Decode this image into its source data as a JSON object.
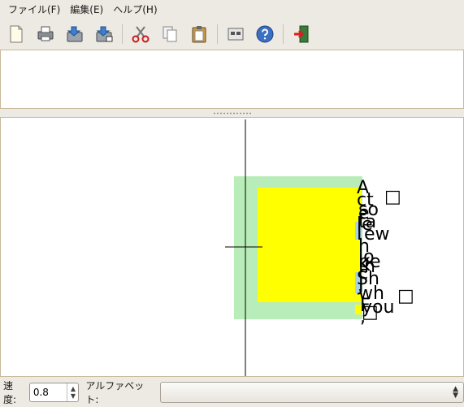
{
  "menu": [
    {
      "label": "ファイル(F)"
    },
    {
      "label": "編集(E)"
    },
    {
      "label": "ヘルプ(H)"
    }
  ],
  "toolbar": {
    "icons": [
      "new-document-icon",
      "print-icon",
      "save-icon",
      "save-as-icon",
      "cut-icon",
      "copy-icon",
      "paste-icon",
      "preferences-icon",
      "help-icon",
      "quit-icon"
    ]
  },
  "canvas": {
    "glyphs": [
      "A",
      "ct",
      "e",
      "so",
      "le",
      "ta",
      "I",
      "ew",
      "h",
      "lo",
      "K",
      "be",
      "c",
      "n",
      "Sh",
      "J",
      "wh",
      "you",
      "F",
      ",",
      "□",
      "□",
      "□"
    ],
    "colors": {
      "outer_block": "#b8ecb8",
      "inner_block": "#ffff00",
      "crosshair": "#000000"
    }
  },
  "status": {
    "speed_label": "速度:",
    "speed_value": "0.8",
    "alphabet_label": "アルファベット:",
    "alphabet_value": ""
  }
}
